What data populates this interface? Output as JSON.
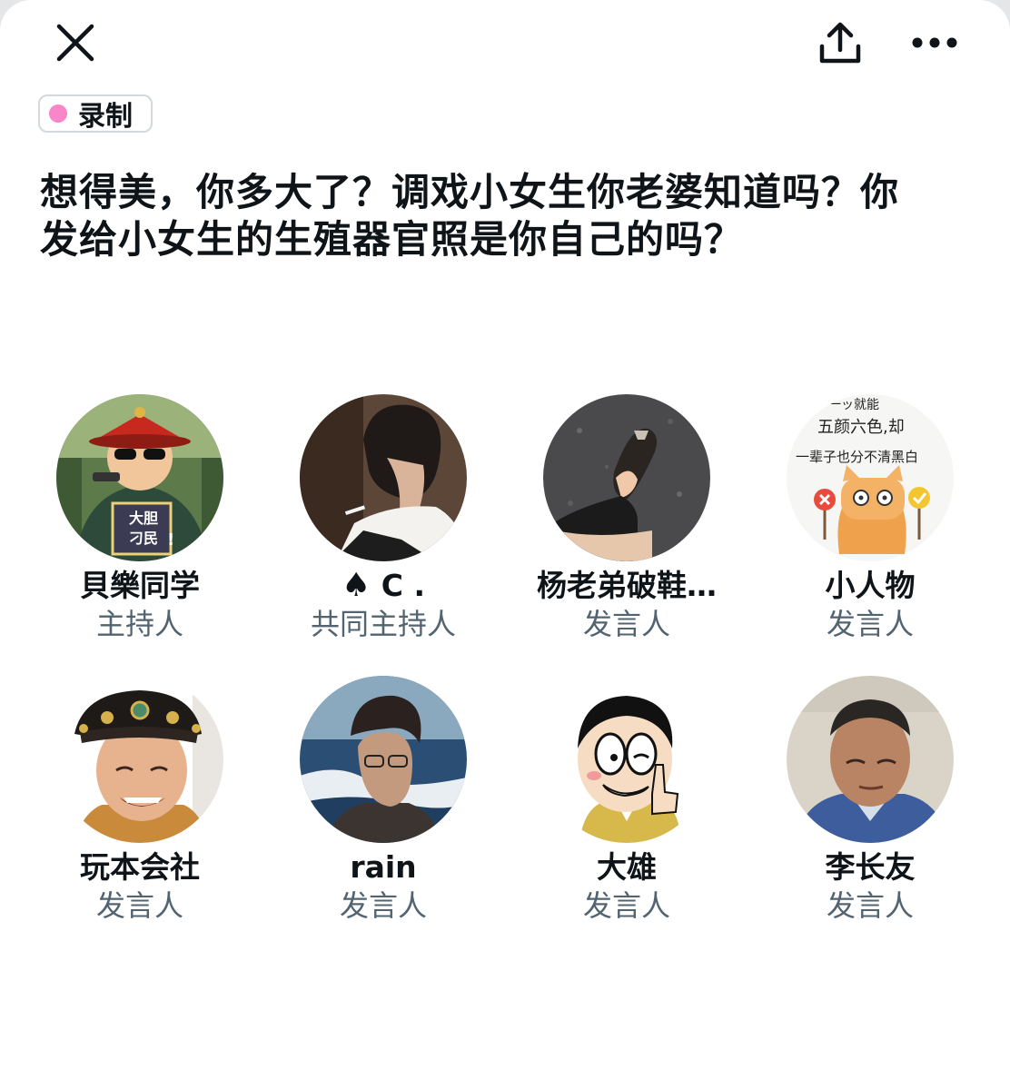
{
  "header": {
    "close_icon": "close-icon",
    "share_icon": "share-icon",
    "more_icon": "more-icon"
  },
  "badge": {
    "label": "录制",
    "dot_color": "#f986c8"
  },
  "title": "想得美，你多大了？调戏小女生你老婆知道吗？你发给小女生的生殖器官照是你自己的吗？",
  "participants": [
    {
      "name": "貝樂同学",
      "role": "主持人"
    },
    {
      "name_icon": "spade-icon",
      "name_symbol": "♠",
      "name": "C .",
      "role": "共同主持人"
    },
    {
      "name": "杨老弟破鞋…",
      "role": "发言人"
    },
    {
      "name": "小人物",
      "role": "发言人"
    },
    {
      "name": "玩本会社",
      "role": "发言人"
    },
    {
      "name": "rain",
      "role": "发言人"
    },
    {
      "name": "大雄",
      "role": "发言人"
    },
    {
      "name": "李长友",
      "role": "发言人"
    }
  ],
  "avatar_texts": {
    "p0": [
      "大胆",
      "刁民",
      "!"
    ],
    "p3": [
      "一ッ就能",
      "五颜六色,却",
      "一辈子也分不清黑白"
    ]
  }
}
